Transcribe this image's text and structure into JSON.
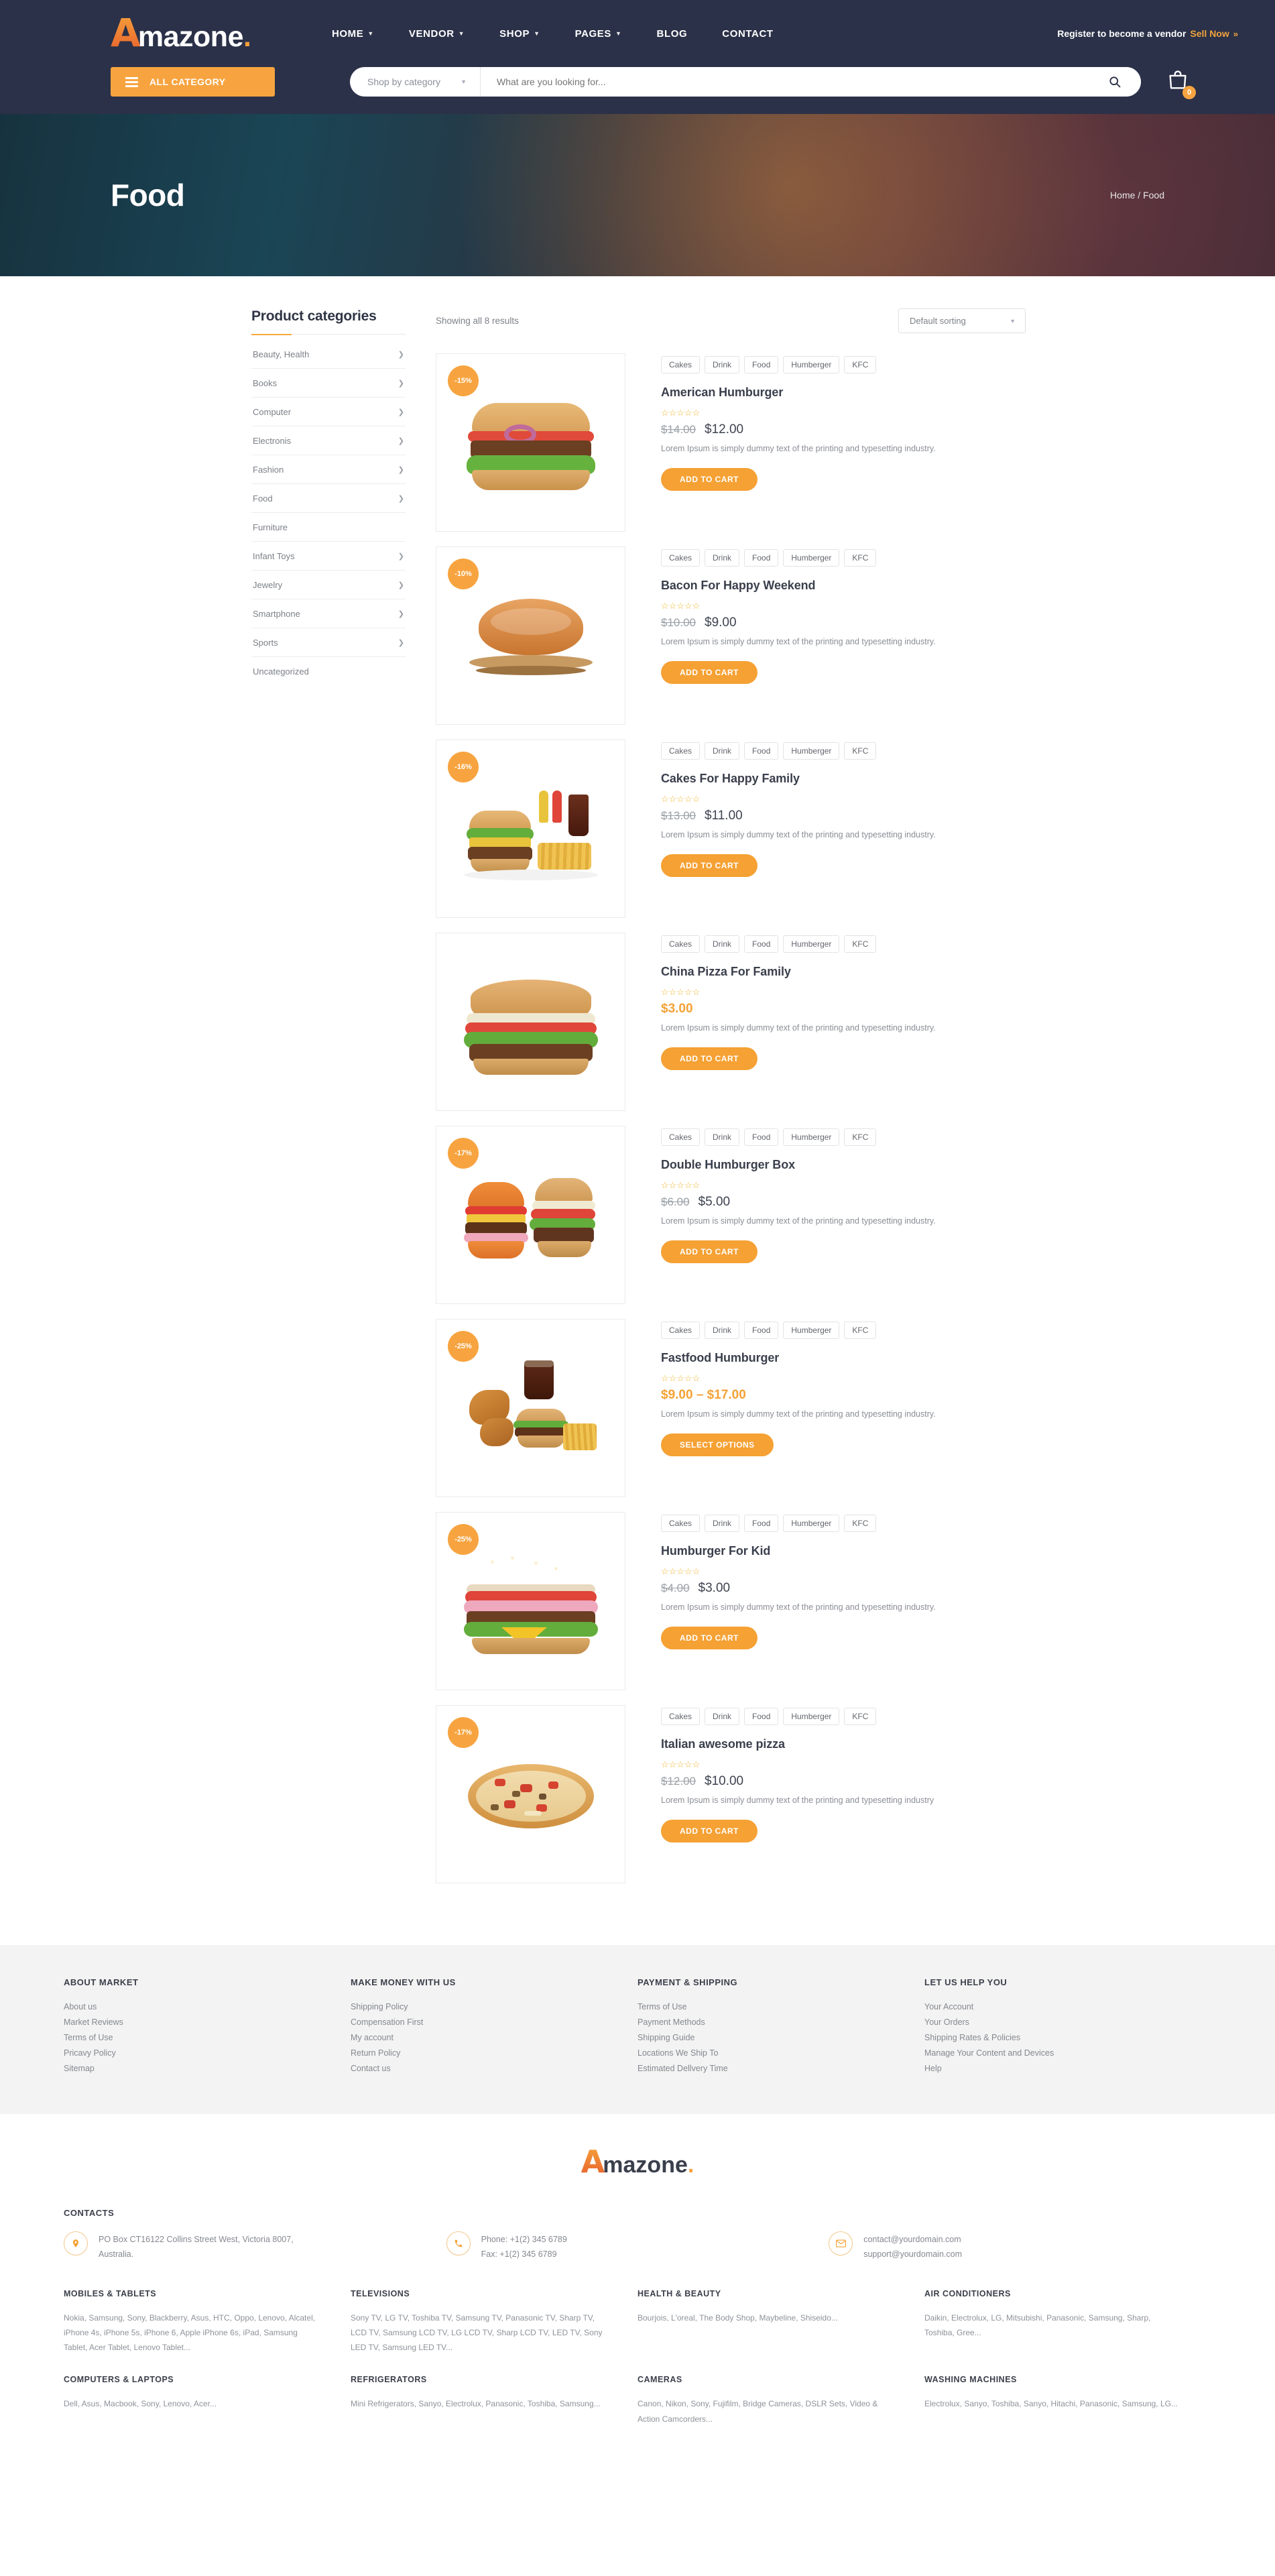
{
  "header": {
    "logo": {
      "initial": "A",
      "name": "mazone",
      "dot": "."
    },
    "nav": [
      {
        "label": "HOME",
        "has_dropdown": true
      },
      {
        "label": "VENDOR",
        "has_dropdown": true
      },
      {
        "label": "SHOP",
        "has_dropdown": true
      },
      {
        "label": "PAGES",
        "has_dropdown": true
      },
      {
        "label": "BLOG",
        "has_dropdown": false
      },
      {
        "label": "CONTACT",
        "has_dropdown": false
      }
    ],
    "register_text": "Register to become a vendor",
    "sell_now": "Sell Now",
    "sell_now_chevron": "»",
    "all_category": "ALL CATEGORY",
    "shop_by_category": "Shop by category",
    "search_placeholder": "What are you looking for...",
    "cart_count": "0"
  },
  "hero": {
    "title": "Food",
    "breadcrumb_home": "Home",
    "breadcrumb_sep": "/",
    "breadcrumb_current": "Food"
  },
  "sidebar": {
    "title": "Product categories",
    "items": [
      {
        "label": "Beauty, Health",
        "chevron": true
      },
      {
        "label": "Books",
        "chevron": true
      },
      {
        "label": "Computer",
        "chevron": true
      },
      {
        "label": "Electronis",
        "chevron": true
      },
      {
        "label": "Fashion",
        "chevron": true
      },
      {
        "label": "Food",
        "chevron": true
      },
      {
        "label": "Furniture",
        "chevron": false
      },
      {
        "label": "Infant Toys",
        "chevron": true
      },
      {
        "label": "Jewelry",
        "chevron": true
      },
      {
        "label": "Smartphone",
        "chevron": true
      },
      {
        "label": "Sports",
        "chevron": true
      },
      {
        "label": "Uncategorized",
        "chevron": false
      }
    ]
  },
  "toolbar": {
    "results": "Showing all 8 results",
    "sorting": "Default sorting"
  },
  "tags": [
    "Cakes",
    "Drink",
    "Food",
    "Humberger",
    "KFC"
  ],
  "labels": {
    "add_to_cart": "ADD TO CART",
    "select_options": "SELECT OPTIONS",
    "stars": "☆☆☆☆☆",
    "description": "Lorem Ipsum is simply dummy text of the printing and typesetting industry."
  },
  "products": [
    {
      "badge": "-15%",
      "title": "American Humburger",
      "old_price": "$14.00",
      "price": "$12.00",
      "price_type": "sale",
      "desc": "Lorem Ipsum is simply dummy text of the printing and typesetting industry.",
      "button": "ADD TO CART",
      "image": "burger-sandwich"
    },
    {
      "badge": "-10%",
      "title": "Bacon For Happy Weekend",
      "old_price": "$10.00",
      "price": "$9.00",
      "price_type": "sale",
      "desc": "Lorem Ipsum is simply dummy text of the printing and typesetting industry.",
      "button": "ADD TO CART",
      "image": "bacon-roast"
    },
    {
      "badge": "-16%",
      "title": "Cakes For Happy Family",
      "old_price": "$13.00",
      "price": "$11.00",
      "price_type": "sale",
      "desc": "Lorem Ipsum is simply dummy text of the printing and typesetting industry.",
      "button": "ADD TO CART",
      "image": "burger-meal"
    },
    {
      "badge": "",
      "title": "China Pizza For Family",
      "old_price": "",
      "price": "$3.00",
      "price_type": "single",
      "desc": "Lorem Ipsum is simply dummy text of the printing and typesetting industry.",
      "button": "ADD TO CART",
      "image": "big-burger"
    },
    {
      "badge": "-17%",
      "title": "Double Humburger Box",
      "old_price": "$6.00",
      "price": "$5.00",
      "price_type": "sale",
      "desc": "Lorem Ipsum is simply dummy text of the printing and typesetting industry.",
      "button": "ADD TO CART",
      "image": "two-burgers"
    },
    {
      "badge": "-25%",
      "title": "Fastfood Humburger",
      "old_price": "",
      "price": "$9.00 – $17.00",
      "price_type": "range",
      "desc": "Lorem Ipsum is simply dummy text of the printing and typesetting industry.",
      "button": "SELECT OPTIONS",
      "image": "fastfood-combo"
    },
    {
      "badge": "-25%",
      "title": "Humburger For Kid",
      "old_price": "$4.00",
      "price": "$3.00",
      "price_type": "sale",
      "desc": "Lorem Ipsum is simply dummy text of the printing and typesetting industry.",
      "button": "ADD TO CART",
      "image": "sesame-burger"
    },
    {
      "badge": "-17%",
      "title": "Italian awesome pizza",
      "old_price": "$12.00",
      "price": "$10.00",
      "price_type": "sale",
      "desc": "Lorem Ipsum is simply dummy text of the printing and typesetting industry",
      "button": "ADD TO CART",
      "image": "pizza"
    }
  ],
  "footer_links": [
    {
      "title": "ABOUT MARKET",
      "items": [
        "About us",
        "Market Reviews",
        "Terms of Use",
        "Pricavy Policy",
        "Sitemap"
      ]
    },
    {
      "title": "MAKE MONEY WITH US",
      "items": [
        "Shipping Policy",
        "Compensation First",
        "My account",
        "Return Policy",
        "Contact us"
      ]
    },
    {
      "title": "PAYMENT & SHIPPING",
      "items": [
        "Terms of Use",
        "Payment Methods",
        "Shipping Guide",
        "Locations We Ship To",
        "Estimated Dellvery Time"
      ]
    },
    {
      "title": "LET US HELP YOU",
      "items": [
        "Your Account",
        "Your Orders",
        "Shipping Rates & Policies",
        "Manage Your Content and Devices",
        "Help"
      ]
    }
  ],
  "footer_logo": {
    "initial": "A",
    "name": "mazone",
    "dot": "."
  },
  "contacts": {
    "title": "CONTACTS",
    "address_line1": "PO Box CT16122 Collins Street West, Victoria 8007,",
    "address_line2": "Australia.",
    "phone_line1": "Phone: +1(2) 345 6789",
    "phone_line2": "Fax: +1(2) 345 6789",
    "email_line1": "contact@yourdomain.com",
    "email_line2": "support@yourdomain.com"
  },
  "mega_footer": [
    {
      "title": "MOBILES & TABLETS",
      "body": "Nokia, Samsung, Sony, Blackberry, Asus, HTC, Oppo, Lenovo, Alcatel, iPhone 4s, iPhone 5s, iPhone 6, Apple iPhone 6s, iPad, Samsung Tablet, Acer Tablet, Lenovo Tablet..."
    },
    {
      "title": "TELEVISIONS",
      "body": "Sony TV, LG TV, Toshiba TV, Samsung TV, Panasonic TV, Sharp TV, LCD TV, Samsung LCD TV, LG LCD TV, Sharp LCD TV, LED TV, Sony LED TV, Samsung LED TV..."
    },
    {
      "title": "HEALTH & BEAUTY",
      "body": "Bourjois, L'oreal, The Body Shop, Maybeline, Shiseido..."
    },
    {
      "title": "AIR CONDITIONERS",
      "body": "Daikin, Electrolux, LG, Mitsubishi, Panasonic, Samsung, Sharp, Toshiba, Gree..."
    },
    {
      "title": "COMPUTERS & LAPTOPS",
      "body": "Dell, Asus, Macbook, Sony, Lenovo, Acer..."
    },
    {
      "title": "REFRIGERATORS",
      "body": "Mini Refrigerators, Sanyo, Electrolux, Panasonic, Toshiba, Samsung..."
    },
    {
      "title": "CAMERAS",
      "body": "Canon, Nikon, Sony, Fujifilm, Bridge Cameras, DSLR Sets, Video & Action Camcorders..."
    },
    {
      "title": "WASHING MACHINES",
      "body": "Electrolux, Sanyo, Toshiba, Sanyo, Hitachi, Panasonic, Samsung, LG..."
    }
  ],
  "colors": {
    "accent": "#f5a134",
    "header_bg": "#2b3148",
    "footer_bg": "#f3f3f3"
  }
}
